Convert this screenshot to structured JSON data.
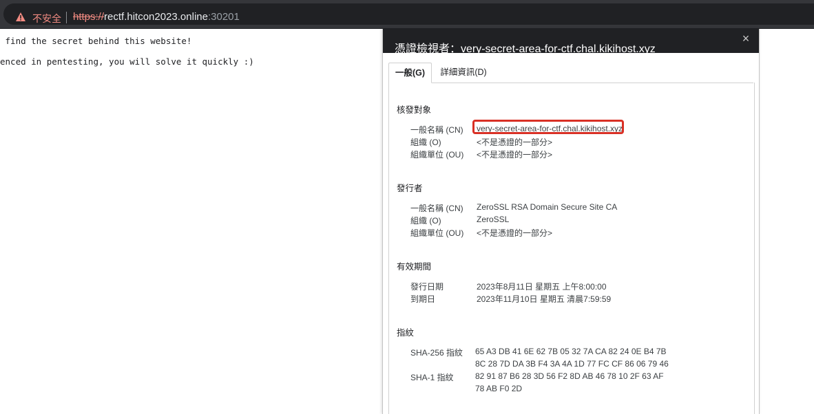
{
  "address_bar": {
    "security_label": "不安全",
    "url_scheme": "https://",
    "url_host": "rectf.hitcon2023.online",
    "url_port": ":30201"
  },
  "page": {
    "lines": [
      " find the secret behind this website!",
      "enced in pentesting, you will solve it quickly :)"
    ]
  },
  "dialog": {
    "title": "憑證檢視者：very-secret-area-for-ctf.chal.kikihost.xyz",
    "close_label": "×",
    "tabs": [
      {
        "label": "一般(G)"
      },
      {
        "label": "詳細資訊(D)"
      }
    ],
    "sections": {
      "subject": {
        "title": "核發對象",
        "fields": [
          {
            "label": "一般名稱 (CN)",
            "value": "very-secret-area-for-ctf.chal.kikihost.xyz"
          },
          {
            "label": "組織 (O)",
            "value": "<不是憑證的一部分>"
          },
          {
            "label": "組織單位 (OU)",
            "value": "<不是憑證的一部分>"
          }
        ]
      },
      "issuer": {
        "title": "發行者",
        "fields": [
          {
            "label": "一般名稱 (CN)",
            "value": "ZeroSSL RSA Domain Secure Site CA"
          },
          {
            "label": "組織 (O)",
            "value": "ZeroSSL"
          },
          {
            "label": "組織單位 (OU)",
            "value": "<不是憑證的一部分>"
          }
        ]
      },
      "validity": {
        "title": "有效期間",
        "fields": [
          {
            "label": "發行日期",
            "value": "2023年8月11日 星期五 上午8:00:00"
          },
          {
            "label": "到期日",
            "value": "2023年11月10日 星期五 清晨7:59:59"
          }
        ]
      },
      "fingerprints": {
        "title": "指紋",
        "fields": [
          {
            "label": "SHA-256 指紋",
            "value_line1": "65 A3 DB 41 6E 62 7B 05 32 7A CA 82 24 0E B4 7B",
            "value_line2": "8C 28 7D DA 3B F4 3A 4A 1D 77 FC CF 86 06 79 46"
          },
          {
            "label": "SHA-1 指紋",
            "value_line1": "82 91 87 B6 28 3D 56 F2 8D AB 46 78 10 2F 63 AF",
            "value_line2": "78 AB F0 2D"
          }
        ]
      }
    }
  },
  "colors": {
    "chrome_bg": "#35363a",
    "omnibox_bg": "#202124",
    "insecure_red": "#f28b82",
    "highlight_red": "#d93025"
  }
}
